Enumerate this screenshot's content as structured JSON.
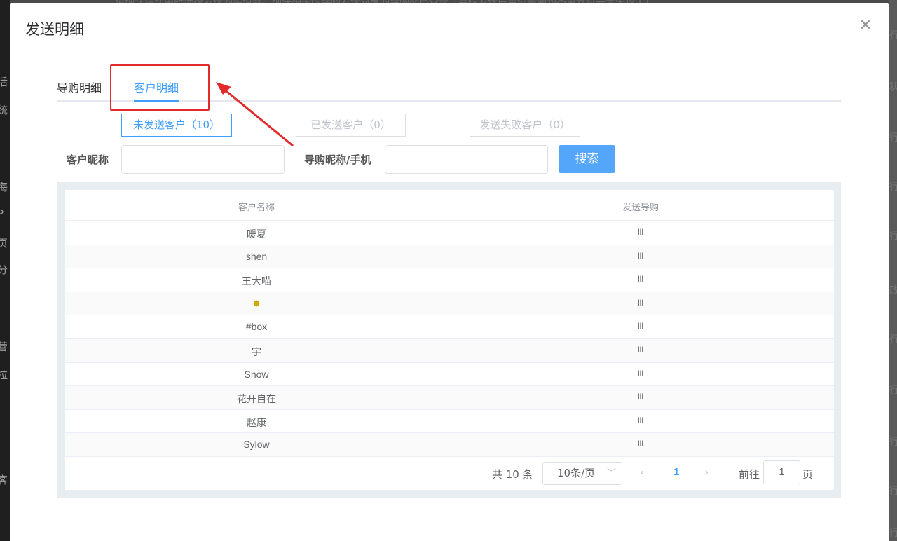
{
  "background": {
    "left_fragments": [
      "活",
      "统",
      "海",
      "P",
      "页",
      "分",
      "营",
      "拉",
      "客"
    ],
    "right_fragments": [
      "状",
      "行",
      "行",
      "行",
      "行",
      "改",
      "行",
      "行",
      "行",
      "行",
      "行"
    ],
    "top_text": "、请确认活动中所选择发送的渠道群，确保相关的导购发送对象的导购都已登录（导购发送后至偏离通知不用支付完全失败了）"
  },
  "dialog": {
    "title": "发送明细",
    "close_icon": "close-icon"
  },
  "tabs": [
    {
      "label": "导购明细",
      "active": false
    },
    {
      "label": "客户明细",
      "active": true
    }
  ],
  "filters": [
    {
      "label": "未发送客户（10）",
      "active": true
    },
    {
      "label": "已发送客户（0）",
      "active": false
    },
    {
      "label": "发送失败客户（0）",
      "active": false
    }
  ],
  "search": {
    "customer_label": "客户昵称",
    "customer_value": "",
    "guide_label": "导购昵称/手机",
    "guide_value": "",
    "button": "搜索"
  },
  "table": {
    "columns": [
      "客户名称",
      "发送导购"
    ],
    "rows": [
      {
        "name": "暖夏",
        "guide": "lll"
      },
      {
        "name": "shen",
        "guide": "lll"
      },
      {
        "name": "王大喵",
        "guide": "lll"
      },
      {
        "name": "✸",
        "guide": "lll"
      },
      {
        "name": "#box",
        "guide": "lll"
      },
      {
        "name": "宇",
        "guide": "lll"
      },
      {
        "name": "Snow",
        "guide": "lll"
      },
      {
        "name": "花开自在",
        "guide": "lll"
      },
      {
        "name": "赵康",
        "guide": "lll"
      },
      {
        "name": "Sylow",
        "guide": "lll"
      }
    ]
  },
  "pagination": {
    "total": "共 10 条",
    "page_size": "10条/页",
    "current_page": "1",
    "goto_label": "前往",
    "goto_value": "1",
    "goto_suffix": "页"
  },
  "colors": {
    "accent": "#409eff",
    "annotation": "#e32a2a"
  }
}
